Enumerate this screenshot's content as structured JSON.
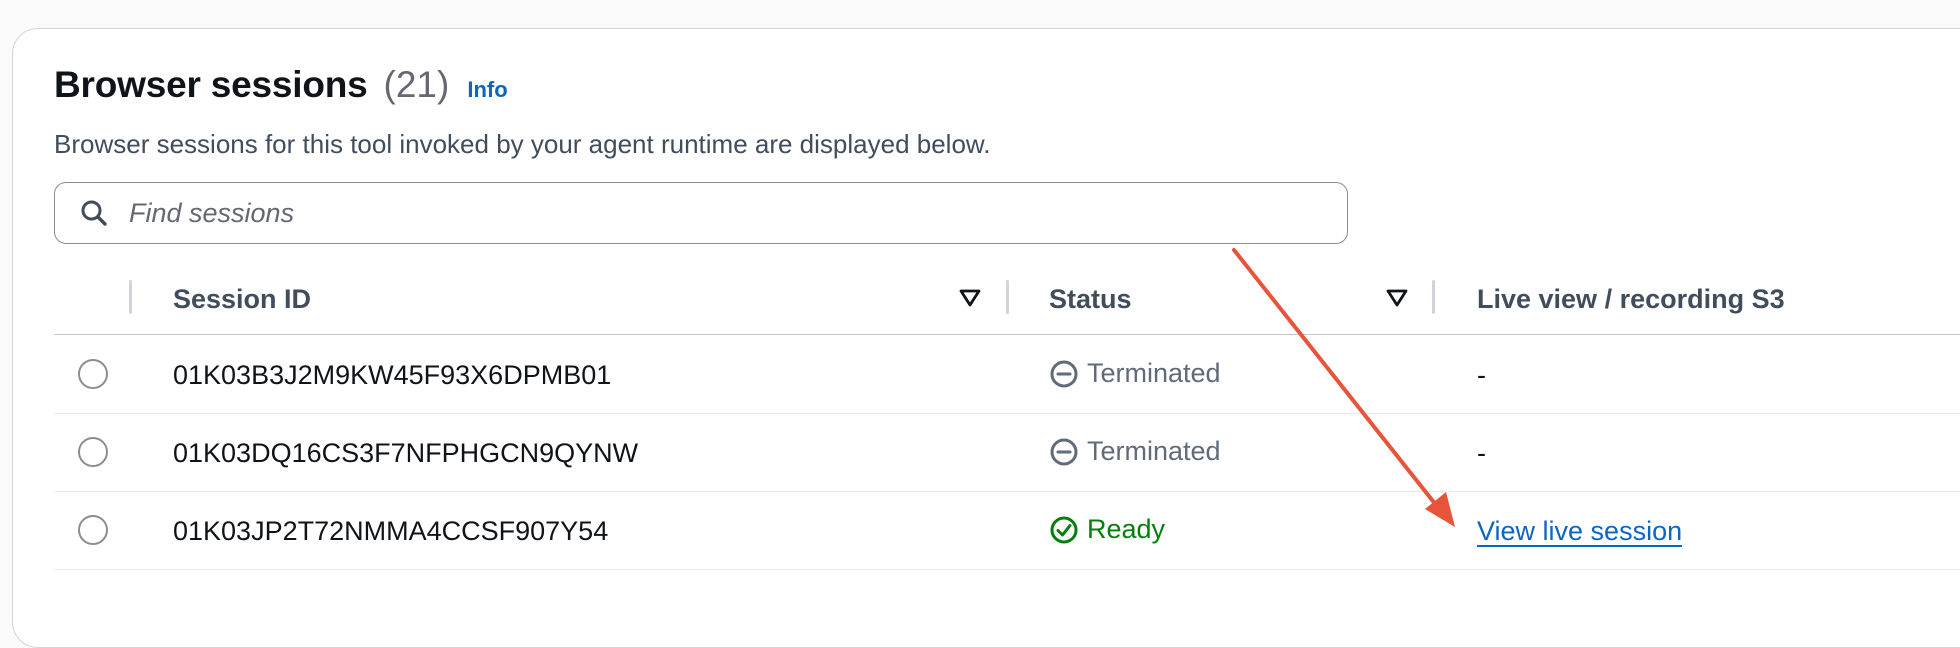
{
  "header": {
    "title": "Browser sessions",
    "count": "(21)",
    "info_label": "Info",
    "description": "Browser sessions for this tool invoked by your agent runtime are displayed below."
  },
  "search": {
    "placeholder": "Find sessions",
    "value": ""
  },
  "table": {
    "columns": [
      "Session ID",
      "Status",
      "Live view / recording S3"
    ],
    "rows": [
      {
        "session_id": "01K03B3J2M9KW45F93X6DPMB01",
        "status": "Terminated",
        "status_icon": "minus-circle-icon",
        "live_view": "-"
      },
      {
        "session_id": "01K03DQ16CS3F7NFPHGCN9QYNW",
        "status": "Terminated",
        "status_icon": "minus-circle-icon",
        "live_view": "-"
      },
      {
        "session_id": "01K03JP2T72NMMA4CCSF907Y54",
        "status": "Ready",
        "status_icon": "check-circle-icon",
        "live_view": "View live session"
      }
    ]
  },
  "colors": {
    "link": "#0b66c3",
    "ready": "#037f0c",
    "terminated": "#5f6b7a",
    "annotation_arrow": "#e8543a"
  }
}
